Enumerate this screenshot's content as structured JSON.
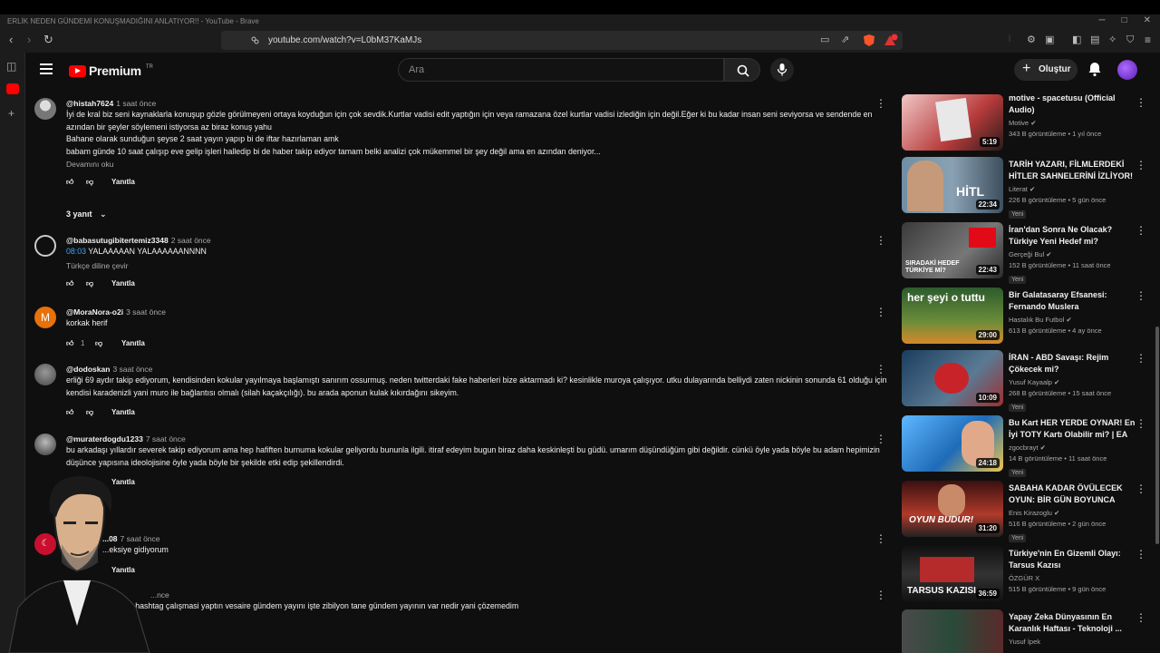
{
  "browser": {
    "window_title": "ERLİK NEDEN GÜNDEMİ KONUŞMADIĞINI ANLATIYOR!! - YouTube - Brave",
    "url": "youtube.com/watch?v=L0bM37KaMJs"
  },
  "header": {
    "logo_text": "Premium",
    "logo_tr": "TR",
    "search_placeholder": "Ara",
    "create_label": "Oluştur"
  },
  "labels": {
    "reply": "Yanıtla",
    "read_more": "Devamını oku",
    "translate": "Türkçe diline çevir",
    "replies_toggle": "3 yanıt"
  },
  "comments": [
    {
      "author": "@histah7624",
      "time": "1 saat önce",
      "text": "İyi de kral biz seni kaynaklarla konuşup gözle görülmeyeni ortaya koyduğun için çok sevdik.Kurtlar vadisi edit yaptığın için veya ramazana özel kurtlar vadisi izlediğin için değil.Eğer ki bu kadar insan seni seviyorsa ve sendende en azından bir şeyler söylemeni istiyorsa az biraz konuş yahu\nBahane olarak sunduğun şeyse 2 saat yayın yapıp bi de iftar hazırlaman amk\nbabam günde 10 saat çalışıp eve gelip işleri halledip bi de haber takip ediyor tamam belki analizi çok mükemmel bir şey değil ama en azından deniyor..."
    },
    {
      "author": "@babasutugibitertemiz3348",
      "time": "2 saat önce",
      "timestamp": "08:03",
      "text": " YALAAAAAN YALAAAAAANNNN"
    },
    {
      "author": "@MoraNora-o2i",
      "time": "3 saat önce",
      "text": "korkak herif",
      "likes": "1"
    },
    {
      "author": "@dodoskan",
      "time": "3 saat önce",
      "text": "erliği 69 aydır takip ediyorum, kendisinden kokular yayılmaya başlamıştı sanırım ossurmuş. neden twitterdaki fake haberleri bize aktarmadı ki? kesinlikle muroya çalışıyor. utku dulayarında belliydi zaten nickinin sonunda 61 olduğu için kendisi karadenizli yani muro ile bağlantısı olmalı (silah kaçakçılığı). bu arada aponun kulak kıkırdağını sikeyim."
    },
    {
      "author": "@muraterdogdu1233",
      "time": "7 saat önce",
      "text": "bu arkadaşı yıllardır severek takip ediyorum ama hep hafiften burnuma kokular geliyordu bununla ilgili. itiraf edeyim bugun biraz daha keskinleşti bu güdü. umarım düşündüğüm gibi değildir. cünkü öyle yada böyle bu adam hepimizin düşünce yapısına ideolojisine öyle yada böyle bir şekilde etki edip şekillendirdi."
    },
    {
      "author": "...08",
      "time": "7 saat önce",
      "text": "...eksiye gidiyorum"
    },
    {
      "author": "",
      "time": "...nce",
      "text": "...nuştun hashtag çalışmasi yaptın vesaire gündem yayını işte zibilyon tane gündem yayının var nedir yani çözemedim"
    }
  ],
  "related": [
    {
      "title": "motive - spacetusu (Official Audio)",
      "channel": "Motive",
      "meta": "343 B görüntüleme • 1 yıl önce",
      "duration": "5:19",
      "badge": ""
    },
    {
      "title": "TARİH YAZARI, FİLMLERDEKİ HİTLER SAHNELERİNİ İZLİYOR!",
      "channel": "Literat",
      "meta": "226 B görüntüleme • 5 gün önce",
      "duration": "22:34",
      "badge": "Yeni",
      "thumb_text": "HİTL"
    },
    {
      "title": "İran'dan Sonra Ne Olacak? Türkiye Yeni Hedef mi?",
      "channel": "Gerçeği Bul",
      "meta": "152 B görüntüleme • 11 saat önce",
      "duration": "22:43",
      "badge": "Yeni",
      "thumb_text": "SIRADAKİ HEDEF TÜRKİYE Mİ?"
    },
    {
      "title": "Bir Galatasaray Efsanesi: Fernando Muslera",
      "channel": "Hastalık Bu Futbol",
      "meta": "613 B görüntüleme • 4 ay önce",
      "duration": "29:00",
      "badge": "",
      "thumb_text": "her şeyi o tuttu"
    },
    {
      "title": "İRAN - ABD Savaşı: Rejim Çökecek mi?",
      "channel": "Yusuf Kayaalp",
      "meta": "268 B görüntüleme • 15 saat önce",
      "duration": "10:09",
      "badge": "Yeni"
    },
    {
      "title": "Bu Kart HER YERDE OYNAR! En İyi TOTY Kartı Olabilir mi? | EA ...",
      "channel": "zgocbrayt",
      "meta": "14 B görüntüleme • 11 saat önce",
      "duration": "24:18",
      "badge": "Yeni"
    },
    {
      "title": "SABAHA KADAR ÖVÜLECEK OYUN: BİR GÜN BOYUNCA GO...",
      "channel": "Enis Kirazoglu",
      "meta": "516 B görüntüleme • 2 gün önce",
      "duration": "31:20",
      "badge": "Yeni",
      "thumb_text": "OYUN BUDUR!"
    },
    {
      "title": "Türkiye'nin En Gizemli Olayı: Tarsus Kazısı",
      "channel": "ÖZGÜR X",
      "meta": "515 B görüntüleme • 9 gün önce",
      "duration": "36:59",
      "badge": "",
      "thumb_text": "TARSUS KAZISI"
    },
    {
      "title": "Yapay Zeka Dünyasının En Karanlık Haftası - Teknoloji ...",
      "channel": "Yusuf İpek",
      "meta": "",
      "duration": "",
      "badge": ""
    }
  ]
}
